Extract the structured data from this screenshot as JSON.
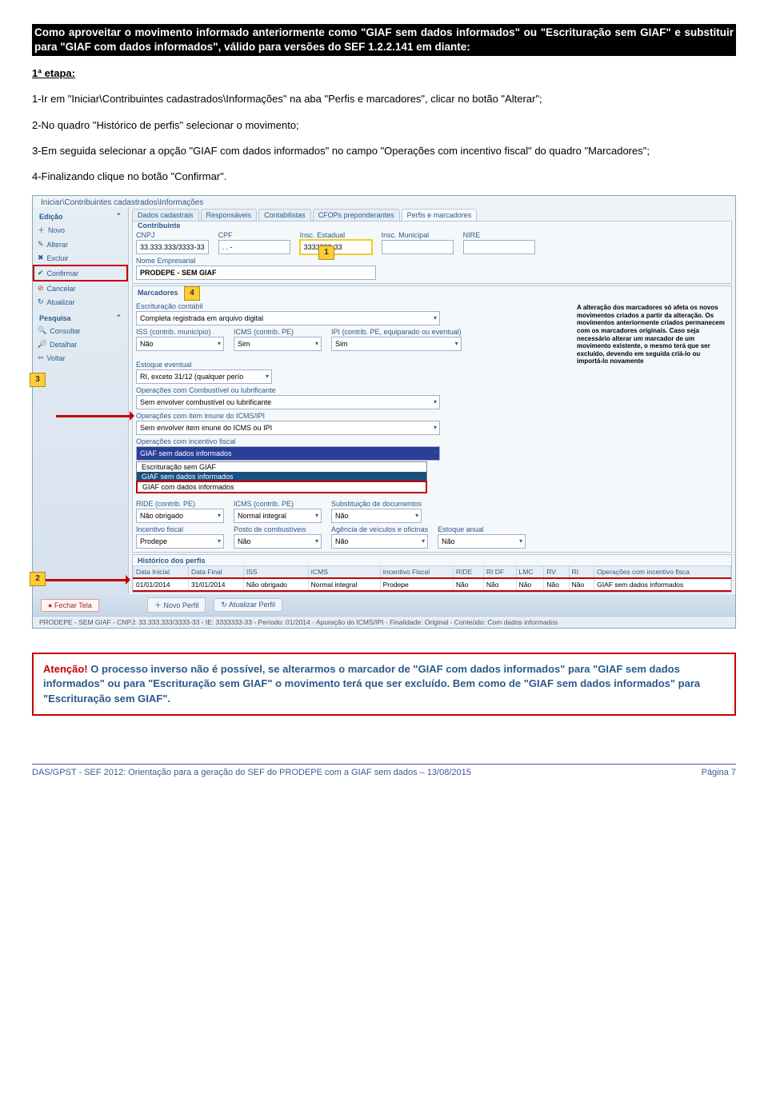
{
  "title": "Como aproveitar o movimento informado anteriormente como \"GIAF sem dados informados\" ou \"Escrituração sem GIAF\" e substituir para \"GIAF com dados informados\", válido para versões do SEF 1.2.2.141 em diante:",
  "etapa": "1ª etapa:",
  "p1_a": "1-Ir em ",
  "p1_q": "\"",
  "p1_b": "Iniciar\\Contribuintes cadastrados\\Informações",
  "p1_c": "\" na aba \"Perfis e marcadores\", clicar no botão \"Alterar\";",
  "p2": "2-No quadro \"Histórico de perfis\" selecionar o movimento;",
  "p3": "3-Em seguida selecionar a opção \"GIAF com dados informados\" no campo \"Operações com incentivo fiscal\" do quadro \"Marcadores\";",
  "p4": "4-Finalizando clique no botão \"Confirmar\".",
  "breadcrumb": "Iniciar\\Contribuintes cadastrados\\Informações",
  "sidebar": {
    "head_edicao": "Edição",
    "novo": "Novo",
    "alterar": "Alterar",
    "excluir": "Excluir",
    "confirmar": "Confirmar",
    "cancelar": "Cancelar",
    "atualizar": "Atualizar",
    "head_pesquisa": "Pesquisa",
    "consultar": "Consultar",
    "detalhar": "Detalhar",
    "voltar": "Voltar"
  },
  "nums": {
    "n1": "1",
    "n2": "2",
    "n3": "3",
    "n4": "4"
  },
  "tabs": {
    "t1": "Dados cadastrais",
    "t2": "Responsáveis",
    "t3": "Contabilistas",
    "t4": "CFOPs preponderantes",
    "t5": "Perfis e marcadores"
  },
  "contr": {
    "frame": "Contribuinte",
    "cnpj_l": "CNPJ",
    "cnpj_v": "33.333.333/3333-33",
    "cpf_l": "CPF",
    "cpf_v": ". . - ",
    "ie_l": "Insc. Estadual",
    "ie_v": "3333333-33",
    "im_l": "Insc. Municipal",
    "nire_l": "NIRE",
    "nome_l": "Nome Empresarial",
    "nome_v": "PRODEPE - SEM GIAF"
  },
  "marc": {
    "frame": "Marcadores",
    "escr_l": "Escrituração contábil",
    "escr_v": "Completa registrada em arquivo digital",
    "iss_l": "ISS (contrib. município)",
    "iss_v": "Não",
    "icms_l": "ICMS (contrib. PE)",
    "icms_v": "Sim",
    "ipi_l": "IPI (contrib. PE, equiparado ou eventual)",
    "ipi_v": "Sim",
    "est_l": "Estoque eventual",
    "est_v": "RI, exceto 31/12 (qualquer perío",
    "comb_l": "Operações com Combustível ou lubrificante",
    "comb_v": "Sem envolver combustível ou lubrificante",
    "imune_l": "Operações com item imune do ICMS/IPI",
    "imune_v": "Sem envolver item imune do ICMS ou IPI",
    "opinc_l": "Operações com incentivo fiscal",
    "opinc_v": "GIAF sem dados informados",
    "combo_a": "Escrituração sem GIAF",
    "combo_b": "GIAF sem dados informados",
    "combo_c": "GIAF com dados informados",
    "ride_l": "RIDE (contrib. PE)",
    "ride_v": "Não obrigado",
    "icms2_l": "ICMS (contrib. PE)",
    "icms2_v": "Normal integral",
    "sub2_l": "Substituição de documentos",
    "sub2_v": "Não",
    "if_l": "Incentivo fiscal",
    "if_v": "Prodepe",
    "posto_l": "Posto de combustíveis",
    "posto_v": "Não",
    "agv_l": "Agência de veículos e oficinas",
    "agv_v": "Não",
    "estanual_l": "Estoque anual",
    "estanual_v": "Não",
    "side_text": "A alteração dos marcadores só afeta os novos movimentos criados a partir da alteração. Os movimentos anteriormente criados permanecem com os marcadores originais. Caso seja necessário alterar um marcador de um movimento existente, o mesmo terá que ser excluído, devendo em seguida criá-lo ou importá-lo novamente"
  },
  "hist": {
    "title": "Histórico dos perfis",
    "cols": [
      "Data Inicial",
      "Data Final",
      "ISS",
      "ICMS",
      "Incentivo Fiscal",
      "RIDE",
      "RI DF",
      "LMC",
      "RV",
      "RI",
      "Operações com incentivo fisca"
    ],
    "row": [
      "01/01/2014",
      "31/01/2014",
      "Não obrigado",
      "Normal integral",
      "Prodepe",
      "Não",
      "Não",
      "Não",
      "Não",
      "Não",
      "GIAF sem dados informados"
    ]
  },
  "footerbtns": {
    "fechar": "Fechar Tela",
    "novo_perfil": "Novo Perfil",
    "atual_perfil": "Atualizar Perfil"
  },
  "statusbar": "PRODEPE - SEM GIAF - CNPJ: 33.333.333/3333-33 - IE: 3333333-33 - Período: 01/2014 - Apuração do ICMS/IPI - Finalidade: Original - Conteúdo: Com dados informados",
  "alert": {
    "head": "Atenção!",
    "body": " O processo inverso não é possível, se alterarmos o marcador de \"GIAF com dados informados\" para \"GIAF sem dados informados\" ou para \"Escrituração sem GIAF\" o movimento terá que ser excluído. Bem como de \"GIAF sem dados informados\" para \"Escrituração sem GIAF\"."
  },
  "footer": {
    "left": "DAS/GPST - SEF 2012: Orientação para a geração do SEF do PRODEPE com a GIAF sem dados – 13/08/2015",
    "right": "Página 7"
  }
}
